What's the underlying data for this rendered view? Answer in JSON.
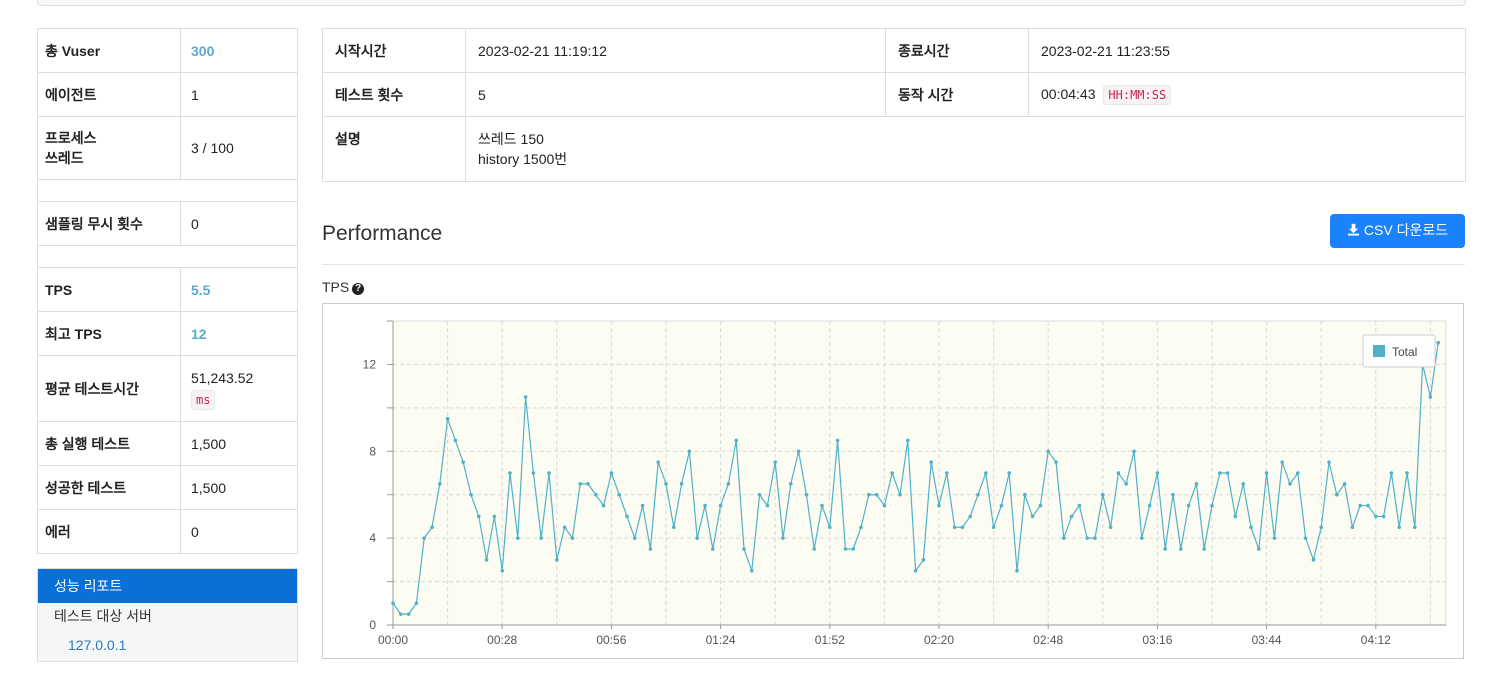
{
  "summary": {
    "total_vuser_label": "총 Vuser",
    "total_vuser": "300",
    "agent_label": "에이전트",
    "agent": "1",
    "process_label_1": "프로세스",
    "process_label_2": "쓰레드",
    "process_thread": "3 / 100",
    "ignore_label": "샘플링 무시 횟수",
    "ignore": "0",
    "tps_label": "TPS",
    "tps": "5.5",
    "peak_label": "최고 TPS",
    "peak": "12",
    "avg_label": "평균 테스트시간",
    "avg": "51,243.52",
    "avg_unit": "ms",
    "total_exec_label": "총 실행 테스트",
    "total_exec": "1,500",
    "success_label": "성공한 테스트",
    "success": "1,500",
    "error_label": "에러",
    "error": "0"
  },
  "menu": {
    "active": "성능 리포트",
    "sub": "테스트 대상 서버",
    "ip": "127.0.0.1"
  },
  "info": {
    "start_label": "시작시간",
    "start": "2023-02-21 11:19:12",
    "end_label": "종료시간",
    "end": "2023-02-21 11:23:55",
    "count_label": "테스트 횟수",
    "count": "5",
    "run_label": "동작 시간",
    "run": "00:04:43",
    "run_unit": "HH:MM:SS",
    "desc_label": "설명",
    "desc_1": "쓰레드 150",
    "desc_2": "history 1500번"
  },
  "performance": {
    "title": "Performance",
    "csv_icon": "download-icon",
    "csv_label": "CSV 다운로드",
    "tps_title": "TPS",
    "help_icon": "question-circle-icon"
  },
  "colors": {
    "accent": "#1a82fb",
    "series": "#4fb2c6",
    "plot_bg": "#fdfcf3"
  },
  "chart_data": {
    "type": "line",
    "xlabel": "",
    "ylabel": "",
    "xlim": [
      0,
      270
    ],
    "ylim": [
      0,
      14
    ],
    "x_ticks": [
      0,
      28,
      56,
      84,
      112,
      140,
      168,
      196,
      224,
      252
    ],
    "x_tick_labels": [
      "00:00",
      "00:28",
      "00:56",
      "01:24",
      "01:52",
      "02:20",
      "02:48",
      "03:16",
      "03:44",
      "04:12"
    ],
    "y_ticks": [
      0,
      4,
      8,
      12
    ],
    "y_tick_labels": [
      "0",
      "4",
      "8",
      "12"
    ],
    "legend_position": "top-right",
    "grid": true,
    "series": [
      {
        "name": "Total",
        "color": "#4fb2c6",
        "x_step": 2,
        "values": [
          1,
          0.5,
          0.5,
          1,
          4,
          4.5,
          6.5,
          9.5,
          8.5,
          7.5,
          6,
          5,
          3,
          5,
          2.5,
          7,
          4,
          10.5,
          7,
          4,
          7,
          3,
          4.5,
          4,
          6.5,
          6.5,
          6,
          5.5,
          7,
          6,
          5,
          4,
          5.5,
          3.5,
          7.5,
          6.5,
          4.5,
          6.5,
          8,
          4,
          5.5,
          3.5,
          5.5,
          6.5,
          8.5,
          3.5,
          2.5,
          6,
          5.5,
          7.5,
          4,
          6.5,
          8,
          6,
          3.5,
          5.5,
          4.5,
          8.5,
          3.5,
          3.5,
          4.5,
          6,
          6,
          5.5,
          7,
          6,
          8.5,
          2.5,
          3,
          7.5,
          5.5,
          7,
          4.5,
          4.5,
          5,
          6,
          7,
          4.5,
          5.5,
          7,
          2.5,
          6,
          5,
          5.5,
          8,
          7.5,
          4,
          5,
          5.5,
          4,
          4,
          6,
          4.5,
          7,
          6.5,
          8,
          4,
          5.5,
          7,
          3.5,
          6,
          3.5,
          5.5,
          6.5,
          3.5,
          5.5,
          7,
          7,
          5,
          6.5,
          4.5,
          3.5,
          7,
          4,
          7.5,
          6.5,
          7,
          4,
          3,
          4.5,
          7.5,
          6,
          6.5,
          4.5,
          5.5,
          5.5,
          5,
          5,
          7,
          4.5,
          7,
          4.5,
          12,
          10.5,
          13
        ]
      }
    ]
  }
}
